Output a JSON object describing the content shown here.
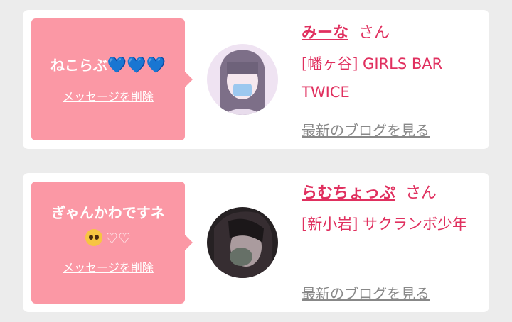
{
  "messages": [
    {
      "message_text": "ねこらぶ",
      "message_hearts": "💙💙💙",
      "delete_label": "メッセージを削除",
      "girl_name": "みーな",
      "honorific": "さん",
      "shop": "[幡ヶ谷] GIRLS BAR TWICE",
      "blog_link": "最新のブログを見る"
    },
    {
      "message_text": "ぎゃんかわですネ",
      "message_emoji": "pleading-face-icon",
      "message_hearts": "♡♡",
      "delete_label": "メッセージを削除",
      "girl_name": "らむちょっぷ",
      "honorific": "さん",
      "shop": "[新小岩] サクランボ少年",
      "blog_link": "最新のブログを見る"
    }
  ],
  "colors": {
    "bubble": "#fb98a5",
    "accent": "#e0305f",
    "link_gray": "#888888",
    "background": "#ececec"
  }
}
